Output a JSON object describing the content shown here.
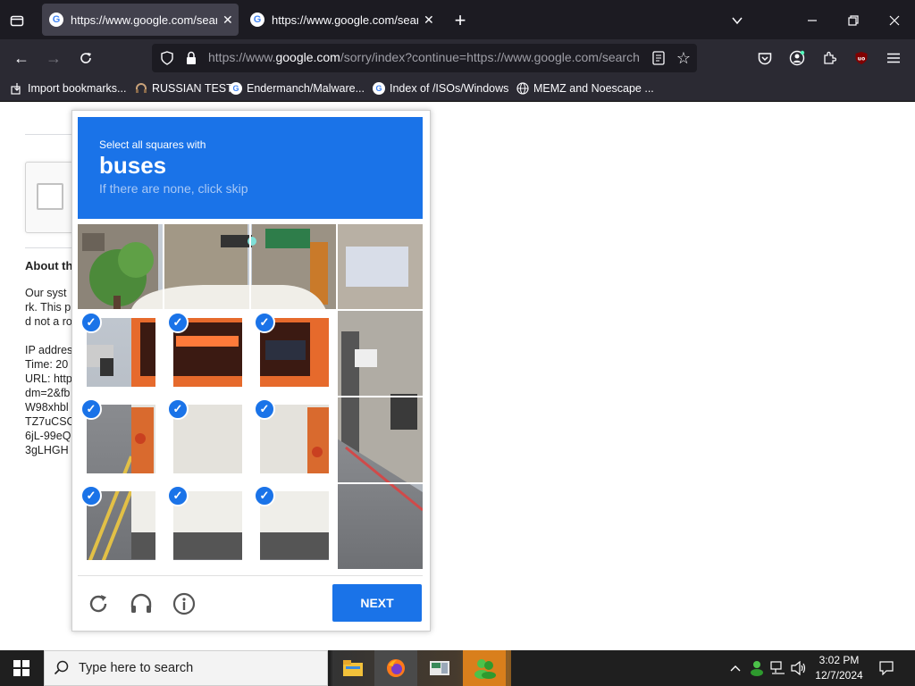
{
  "browser": {
    "tabs": [
      {
        "title": "https://www.google.com/search?q=...",
        "favicon": "google-g-icon"
      },
      {
        "title": "https://www.google.com/search?q=...",
        "favicon": "google-g-icon"
      }
    ],
    "new_tab": "+",
    "url": {
      "prefix": "https://www.",
      "domain": "google.com",
      "rest": "/sorry/index?continue=https://www.google.com/search"
    },
    "bookmarks": [
      {
        "label": "Import bookmarks...",
        "icon": "import-icon"
      },
      {
        "label": "RUSSIAN TEST",
        "icon": "headset-icon"
      },
      {
        "label": "Endermanch/Malware...",
        "icon": "google-g-icon"
      },
      {
        "label": "Index of /ISOs/Windows",
        "icon": "google-g-icon"
      },
      {
        "label": "MEMZ and Noescape ...",
        "icon": "globe-icon"
      }
    ]
  },
  "page": {
    "heading": "About th",
    "para1": [
      "Our syst",
      "rk. This p",
      "d not a ro"
    ],
    "details": [
      "IP addres",
      "Time: 20",
      "URL: http",
      "dm=2&fb",
      "W98xhbl",
      "TZ7uCSC",
      "6jL-99eQ",
      "3gLHGH"
    ]
  },
  "captcha": {
    "instruction": "Select all squares with",
    "target": "buses",
    "hint": "If there are none, click skip",
    "next_label": "NEXT",
    "header_color": "#1a73e8",
    "tiles_selected": [
      [
        false,
        false,
        false,
        false
      ],
      [
        true,
        true,
        true,
        false
      ],
      [
        true,
        true,
        true,
        false
      ],
      [
        true,
        true,
        true,
        false
      ]
    ]
  },
  "taskbar": {
    "search_placeholder": "Type here to search",
    "time": "3:02 PM",
    "date": "12/7/2024"
  }
}
